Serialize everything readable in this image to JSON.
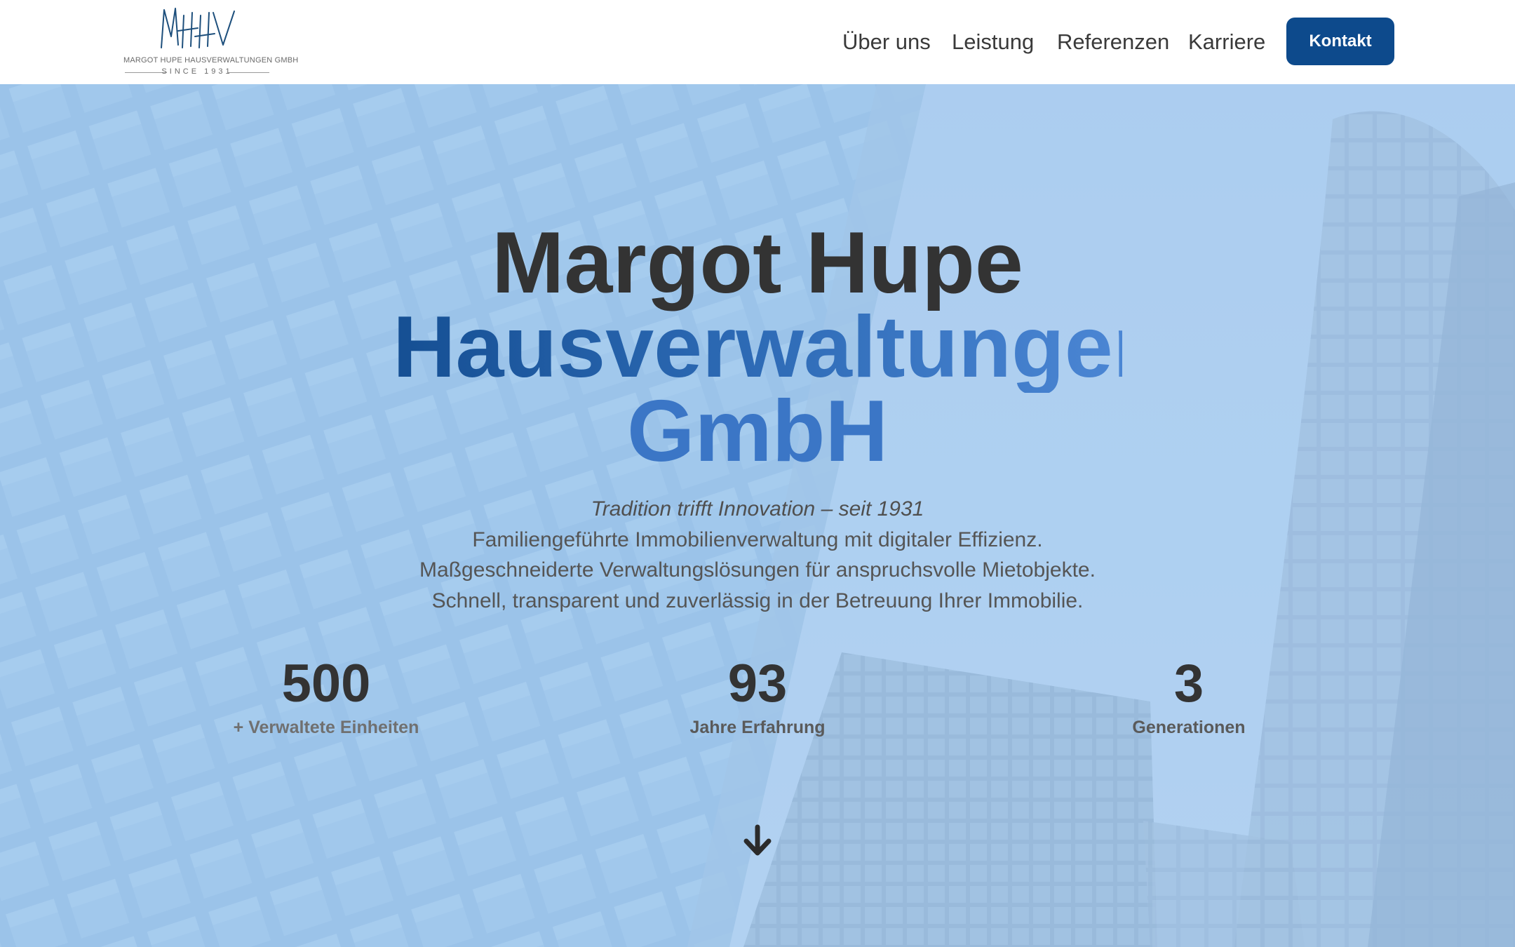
{
  "header": {
    "logo": {
      "monogram": "MHHV",
      "company": "MARGOT HUPE HAUSVERWALTUNGEN GMBH",
      "since": "SINCE 1931"
    },
    "nav": [
      {
        "label": "Über uns"
      },
      {
        "label": "Leistung"
      },
      {
        "label": "Referenzen"
      },
      {
        "label": "Karriere"
      }
    ],
    "cta_label": "Kontakt"
  },
  "hero": {
    "title_line1": "Margot Hupe",
    "title_line2": "Hausverwaltungen",
    "title_line3": "GmbH",
    "tagline": "Tradition trifft Innovation – seit 1931",
    "description": [
      "Familiengeführte Immobilienverwaltung mit digitaler Effizienz.",
      "Maßgeschneiderte Verwaltungslösungen für anspruchsvolle Mietobjekte.",
      "Schnell, transparent und zuverlässig in der Betreuung Ihrer Immobilie."
    ],
    "stats": [
      {
        "value": "500",
        "label": "+ Verwaltete Einheiten"
      },
      {
        "value": "93",
        "label": "Jahre Erfahrung"
      },
      {
        "value": "3",
        "label": "Generationen"
      }
    ],
    "scroll_icon": "arrow-down-icon"
  },
  "colors": {
    "brand_blue": "#0d4a8c",
    "title_dark": "#333333",
    "title_blue_start": "#154f93",
    "title_blue_end": "#4b86d4",
    "hero_tint": "#a7c8ea"
  }
}
